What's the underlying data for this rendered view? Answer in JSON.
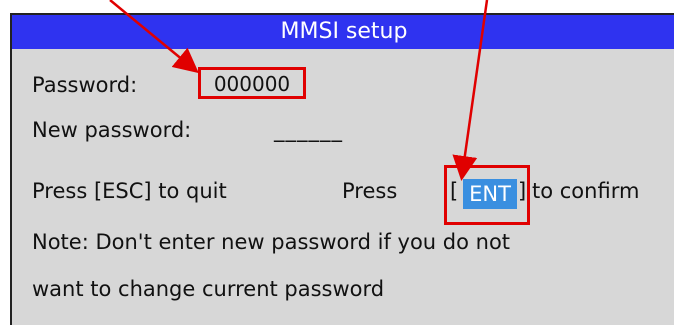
{
  "window": {
    "title": "MMSI setup"
  },
  "password": {
    "label": "Password:",
    "value": "000000"
  },
  "new_password": {
    "label": "New password:",
    "value": "______"
  },
  "hints": {
    "esc": "Press [ESC] to quit",
    "press": "Press",
    "bracket_open": "[",
    "ent_key": "ENT",
    "bracket_close": "]",
    "confirm": "to confirm"
  },
  "note": {
    "line1": "Note: Don't enter new password if you do not",
    "line2": "want to change current password"
  },
  "colors": {
    "titlebar": "#2f33f0",
    "panel": "#d7d7d7",
    "highlight": "#e00000",
    "ent_key": "#3a8fe0"
  }
}
